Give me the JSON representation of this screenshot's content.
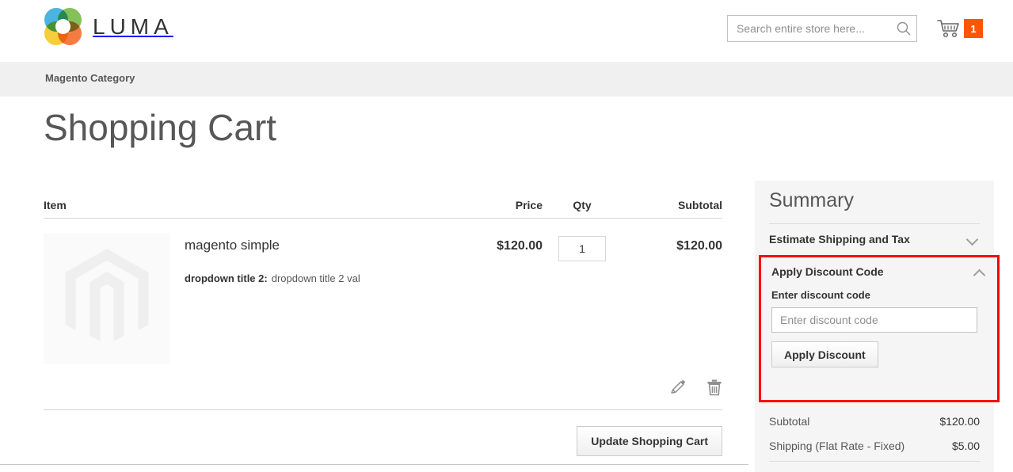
{
  "header": {
    "logo_text": "LUMA",
    "logo_icon": "luma-flower-logo",
    "search": {
      "placeholder": "Search entire store here...",
      "value": "",
      "icon": "search-icon"
    },
    "cart": {
      "icon": "shopping-cart-icon",
      "count": "1",
      "badge_color": "#ff5501"
    }
  },
  "nav": {
    "items": [
      {
        "label": "Magento Category"
      }
    ]
  },
  "main": {
    "page_title": "Shopping Cart",
    "table": {
      "headers": {
        "item": "Item",
        "price": "Price",
        "qty": "Qty",
        "subtotal": "Subtotal"
      },
      "rows": [
        {
          "image_icon": "magento-placeholder-image",
          "name": "magento simple",
          "options": [
            {
              "label": "dropdown title 2:",
              "value": "dropdown title 2 val"
            }
          ],
          "price": "$120.00",
          "qty": "1",
          "subtotal": "$120.00",
          "edit_icon": "pencil-edit-icon",
          "delete_icon": "trash-delete-icon"
        }
      ]
    },
    "update_button": "Update Shopping Cart"
  },
  "summary": {
    "title": "Summary",
    "estimate_shipping": {
      "label": "Estimate Shipping and Tax",
      "chevron": "chevron-down-icon",
      "expanded": false
    },
    "discount": {
      "label": "Apply Discount Code",
      "chevron": "chevron-up-icon",
      "expanded": true,
      "field_label": "Enter discount code",
      "placeholder": "Enter discount code",
      "value": "",
      "apply_button": "Apply Discount",
      "highlight_color": "#ff0000"
    },
    "totals": [
      {
        "label": "Subtotal",
        "value": "$120.00"
      },
      {
        "label": "Shipping (Flat Rate - Fixed)",
        "value": "$5.00"
      }
    ]
  }
}
